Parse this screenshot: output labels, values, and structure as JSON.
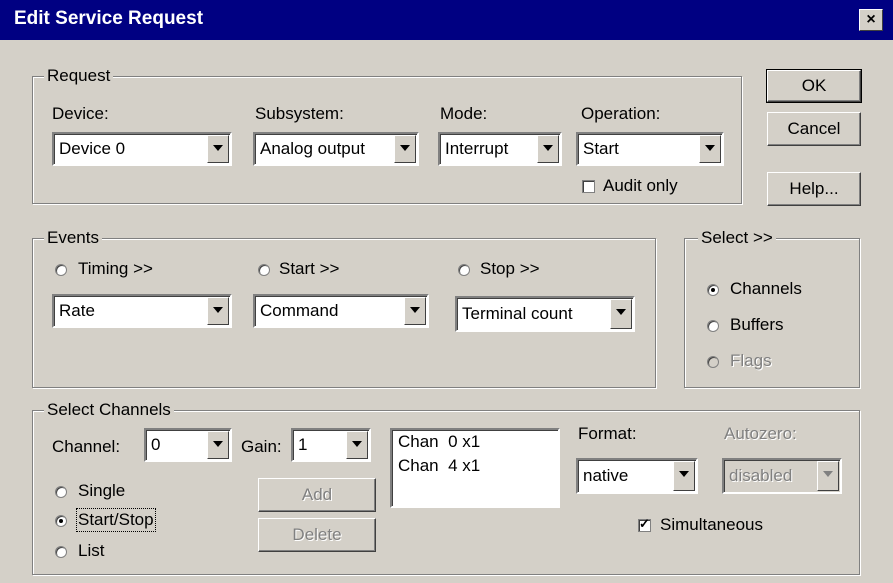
{
  "window": {
    "title": "Edit Service Request",
    "close": "×"
  },
  "request": {
    "legend": "Request",
    "device_label": "Device:",
    "device_value": "Device 0",
    "subsystem_label": "Subsystem:",
    "subsystem_value": "Analog output",
    "mode_label": "Mode:",
    "mode_value": "Interrupt",
    "operation_label": "Operation:",
    "operation_value": "Start",
    "audit_label": "Audit only",
    "audit_checked": false
  },
  "buttons": {
    "ok": "OK",
    "cancel": "Cancel",
    "help": "Help..."
  },
  "events": {
    "legend": "Events",
    "timing_label": "Timing >>",
    "timing_value": "Rate",
    "start_label": "Start >>",
    "start_value": "Command",
    "stop_label": "Stop >>",
    "stop_value": "Terminal count"
  },
  "select": {
    "legend": "Select >>",
    "options": [
      "Channels",
      "Buffers",
      "Flags"
    ],
    "selected": "Channels"
  },
  "channels": {
    "legend": "Select Channels",
    "channel_label": "Channel:",
    "channel_value": "0",
    "gain_label": "Gain:",
    "gain_value": "1",
    "list_items": [
      "Chan  0 x1",
      "Chan  4 x1"
    ],
    "format_label": "Format:",
    "format_value": "native",
    "autozero_label": "Autozero:",
    "autozero_value": "disabled",
    "mode_options": [
      "Single",
      "Start/Stop",
      "List"
    ],
    "mode_selected": "Start/Stop",
    "add_label": "Add",
    "delete_label": "Delete",
    "simultaneous_label": "Simultaneous",
    "simultaneous_checked": true
  }
}
